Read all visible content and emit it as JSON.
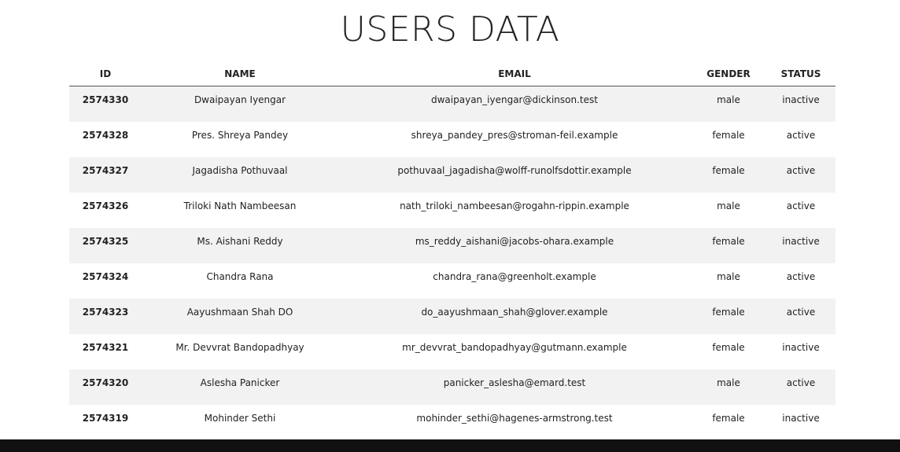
{
  "page": {
    "title": "USERS DATA"
  },
  "table": {
    "headers": {
      "id": "ID",
      "name": "NAME",
      "email": "EMAIL",
      "gender": "GENDER",
      "status": "STATUS"
    },
    "rows": [
      {
        "id": "2574330",
        "name": "Dwaipayan Iyengar",
        "email": "dwaipayan_iyengar@dickinson.test",
        "gender": "male",
        "status": "inactive"
      },
      {
        "id": "2574328",
        "name": "Pres. Shreya Pandey",
        "email": "shreya_pandey_pres@stroman-feil.example",
        "gender": "female",
        "status": "active"
      },
      {
        "id": "2574327",
        "name": "Jagadisha Pothuvaal",
        "email": "pothuvaal_jagadisha@wolff-runolfsdottir.example",
        "gender": "female",
        "status": "active"
      },
      {
        "id": "2574326",
        "name": "Triloki Nath Nambeesan",
        "email": "nath_triloki_nambeesan@rogahn-rippin.example",
        "gender": "male",
        "status": "active"
      },
      {
        "id": "2574325",
        "name": "Ms. Aishani Reddy",
        "email": "ms_reddy_aishani@jacobs-ohara.example",
        "gender": "female",
        "status": "inactive"
      },
      {
        "id": "2574324",
        "name": "Chandra Rana",
        "email": "chandra_rana@greenholt.example",
        "gender": "male",
        "status": "active"
      },
      {
        "id": "2574323",
        "name": "Aayushmaan Shah DO",
        "email": "do_aayushmaan_shah@glover.example",
        "gender": "female",
        "status": "active"
      },
      {
        "id": "2574321",
        "name": "Mr. Devvrat Bandopadhyay",
        "email": "mr_devvrat_bandopadhyay@gutmann.example",
        "gender": "female",
        "status": "inactive"
      },
      {
        "id": "2574320",
        "name": "Aslesha Panicker",
        "email": "panicker_aslesha@emard.test",
        "gender": "male",
        "status": "active"
      },
      {
        "id": "2574319",
        "name": "Mohinder Sethi",
        "email": "mohinder_sethi@hagenes-armstrong.test",
        "gender": "female",
        "status": "inactive"
      }
    ]
  },
  "colors": {
    "row_shade": "#f2f2f2",
    "footer_bar": "#111111",
    "text": "#222222"
  }
}
